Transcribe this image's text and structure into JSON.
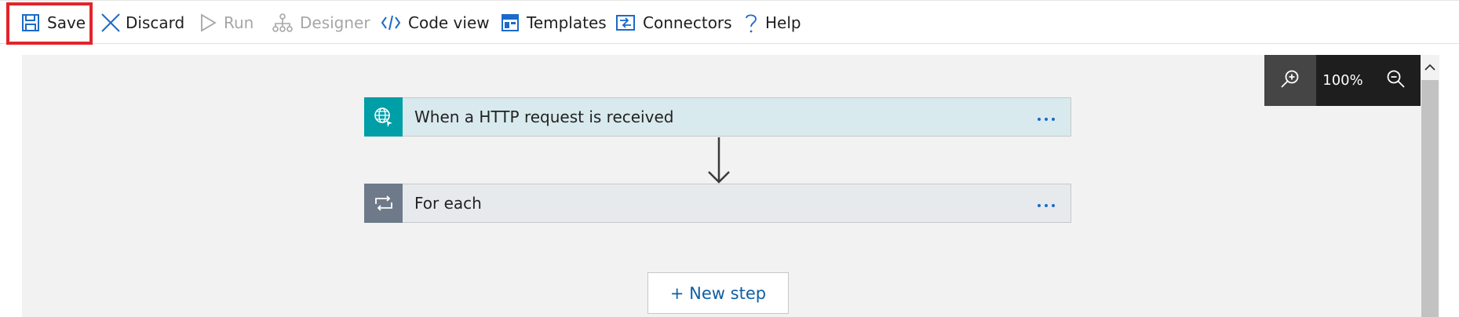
{
  "toolbar": {
    "save": "Save",
    "discard": "Discard",
    "run": "Run",
    "designer": "Designer",
    "code_view": "Code view",
    "templates": "Templates",
    "connectors": "Connectors",
    "help": "Help"
  },
  "zoom": {
    "level": "100%"
  },
  "workflow": {
    "steps": [
      {
        "title": "When a HTTP request is received",
        "icon": "http-request-globe-icon",
        "color": "#009ea6"
      },
      {
        "title": "For each",
        "icon": "loop-icon",
        "color": "#6e7a8a"
      }
    ],
    "new_step": "+ New step"
  },
  "colors": {
    "accent": "#0f5fa6",
    "highlight": "#e3242b"
  }
}
